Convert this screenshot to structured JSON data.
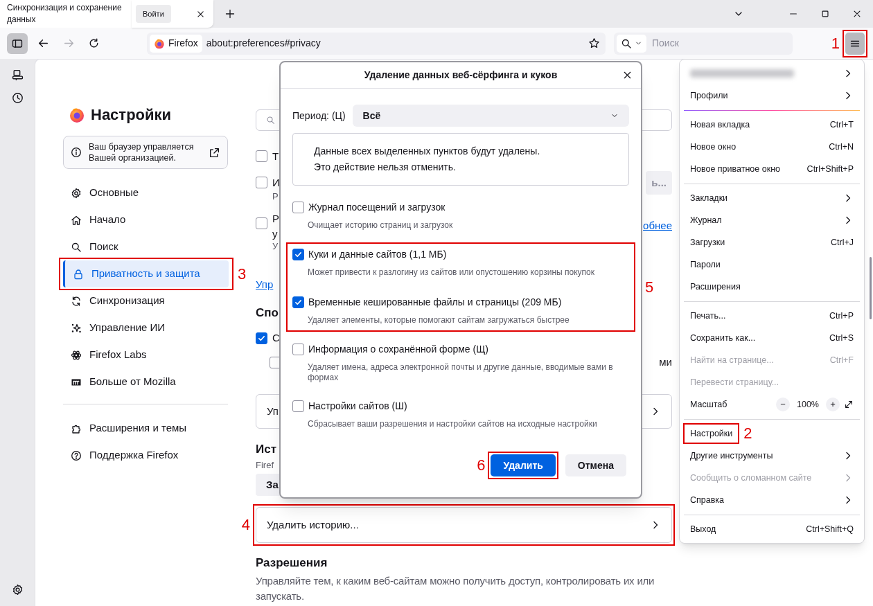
{
  "tab_bar": {
    "page_title": "Синхронизация и сохранение данных",
    "sign_in_button": "Войти"
  },
  "toolbar": {
    "identity_label": "Firefox",
    "url": "about:preferences#privacy",
    "search_placeholder": "Поиск",
    "menu_annotation": "1"
  },
  "settings_nav": {
    "title": "Настройки",
    "notice": "Ваш браузер управляется Вашей организацией.",
    "items": [
      {
        "label": "Основные",
        "selected": false
      },
      {
        "label": "Начало",
        "selected": false
      },
      {
        "label": "Поиск",
        "selected": false
      },
      {
        "label": "Приватность и защита",
        "selected": true,
        "annotation": "3"
      },
      {
        "label": "Синхронизация",
        "selected": false
      },
      {
        "label": "Управление ИИ",
        "selected": false
      },
      {
        "label": "Firefox Labs",
        "selected": false
      },
      {
        "label": "Больше от Mozilla",
        "selected": false
      }
    ],
    "footer_items": [
      {
        "label": "Расширения и темы",
        "selected": false
      },
      {
        "label": "Поддержка Firefox",
        "selected": false
      }
    ]
  },
  "content": {
    "options": [
      {
        "text": "Т",
        "checked": false
      },
      {
        "text": "И",
        "checked": false,
        "note": "Р",
        "button": "ь..."
      },
      {
        "text": "Р",
        "checked": false,
        "lines": [
          "у",
          "У"
        ],
        "link": "обнее"
      }
    ],
    "link": "Упр",
    "section_heading": "Спо",
    "sub_options": [
      {
        "text": "С",
        "checked": true
      },
      {
        "checked": false,
        "trailing": "ми"
      }
    ],
    "card_label": "Уп",
    "history_heading": "Ист",
    "history_note": "Firef",
    "history_button": "За",
    "clear_history": {
      "label": "Удалить историю...",
      "annotation": "4"
    },
    "permissions": {
      "heading": "Разрешения",
      "text": "Управляйте тем, к каким веб-сайтам можно получить доступ, контролировать их или запускать."
    }
  },
  "dialog": {
    "title": "Удаление данных веб-сёрфинга и куков",
    "period_label": "Период: (Ц)",
    "period_value": "Всё",
    "warning_lines": [
      "Данные всех выделенных пунктов будут удалены.",
      "Это действие нельзя отменить."
    ],
    "item_groups": [
      {
        "items": [
          {
            "label": "Журнал посещений и загрузок",
            "description": "Очищает историю страниц и загрузок",
            "checked": false
          }
        ]
      },
      {
        "annotation": "5",
        "items": [
          {
            "label": "Куки и данные сайтов (1,1 МБ)",
            "description": "Может привести к разлогину из сайтов или опустошению корзины покупок",
            "checked": true
          },
          {
            "label": "Временные кешированные файлы и страницы (209 МБ)",
            "description": "Удаляет элементы, которые помогают сайтам загружаться быстрее",
            "checked": true
          }
        ]
      },
      {
        "items": [
          {
            "label": "Информация о сохранённой форме (Щ)",
            "description": "Удаляет имена, адреса электронной почты и другие данные, вводимые вами в формах",
            "checked": false
          },
          {
            "label": "Настройки сайтов (Ш)",
            "description": "Сбрасывает ваши разрешения и настройки сайтов на исходные настройки",
            "checked": false
          }
        ]
      }
    ],
    "buttons": [
      {
        "label": "Удалить",
        "primary": true,
        "annotation": "6"
      },
      {
        "label": "Отмена",
        "primary": false
      }
    ]
  },
  "app_menu": {
    "items": [
      {
        "kind": "blurred",
        "submenu": true
      },
      {
        "kind": "item",
        "label": "Профили",
        "submenu": true,
        "disabled": false
      },
      {
        "kind": "separator",
        "accent": true
      },
      {
        "kind": "item",
        "label": "Новая вкладка",
        "shortcut": "Ctrl+T",
        "submenu": false,
        "disabled": false
      },
      {
        "kind": "item",
        "label": "Новое окно",
        "shortcut": "Ctrl+N",
        "submenu": false,
        "disabled": false
      },
      {
        "kind": "item",
        "label": "Новое приватное окно",
        "shortcut": "Ctrl+Shift+P",
        "submenu": false,
        "disabled": false
      },
      {
        "kind": "separator",
        "accent": false
      },
      {
        "kind": "item",
        "label": "Закладки",
        "submenu": true,
        "disabled": false
      },
      {
        "kind": "item",
        "label": "Журнал",
        "submenu": true,
        "disabled": false
      },
      {
        "kind": "item",
        "label": "Загрузки",
        "shortcut": "Ctrl+J",
        "submenu": false,
        "disabled": false
      },
      {
        "kind": "item",
        "label": "Пароли",
        "submenu": false,
        "disabled": false
      },
      {
        "kind": "item",
        "label": "Расширения",
        "submenu": false,
        "disabled": false
      },
      {
        "kind": "separator",
        "accent": false
      },
      {
        "kind": "item",
        "label": "Печать...",
        "shortcut": "Ctrl+P",
        "submenu": false,
        "disabled": false
      },
      {
        "kind": "item",
        "label": "Сохранить как...",
        "shortcut": "Ctrl+S",
        "submenu": false,
        "disabled": false
      },
      {
        "kind": "item",
        "label": "Найти на странице...",
        "shortcut": "Ctrl+F",
        "submenu": false,
        "disabled": true
      },
      {
        "kind": "item",
        "label": "Перевести страницу...",
        "submenu": false,
        "disabled": true
      },
      {
        "kind": "zoom",
        "label": "Масштаб",
        "zoom_out": "−",
        "value": "100%",
        "zoom_in": "+"
      },
      {
        "kind": "separator",
        "accent": false
      },
      {
        "kind": "item",
        "label": "Настройки",
        "submenu": false,
        "disabled": false,
        "annotation": "2"
      },
      {
        "kind": "item",
        "label": "Другие инструменты",
        "submenu": true,
        "disabled": false
      },
      {
        "kind": "item",
        "label": "Сообщить о сломанном сайте",
        "submenu": true,
        "disabled": true
      },
      {
        "kind": "item",
        "label": "Справка",
        "submenu": true,
        "disabled": false
      },
      {
        "kind": "separator",
        "accent": false
      },
      {
        "kind": "item",
        "label": "Выход",
        "shortcut": "Ctrl+Shift+Q",
        "submenu": false,
        "disabled": false
      }
    ]
  }
}
